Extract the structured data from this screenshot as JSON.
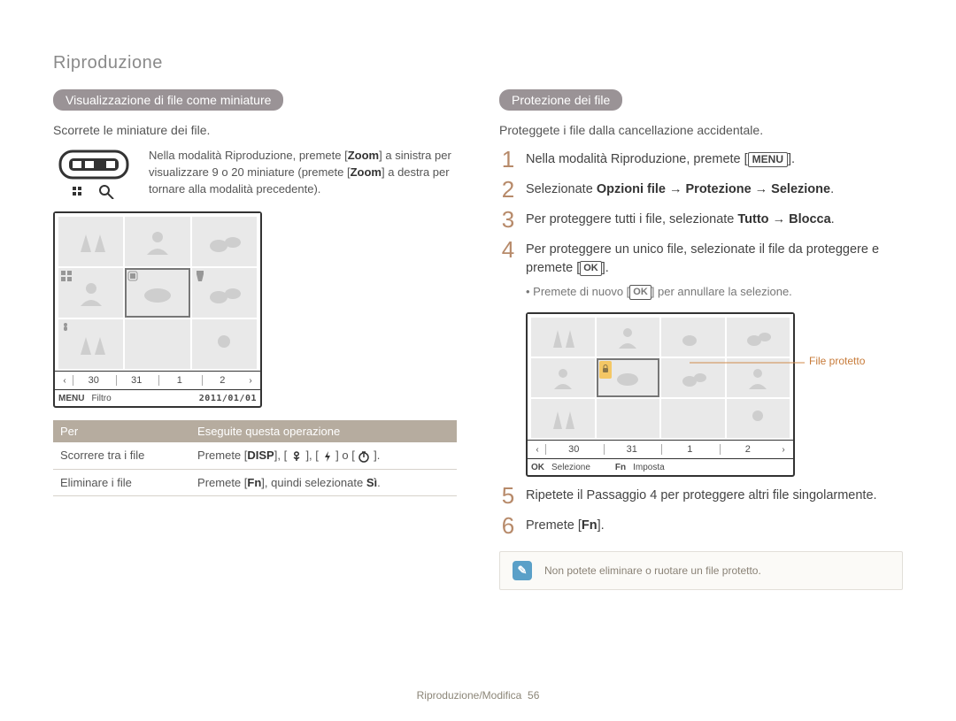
{
  "breadcrumb": "Riproduzione",
  "left": {
    "heading_pill": "Visualizzazione di file come miniature",
    "lead": "Scorrete le miniature dei file.",
    "zoom_hint_a": "Nella modalità Riproduzione, premete [",
    "zoom_label": "Zoom",
    "zoom_hint_b": "] a sinistra per visualizzare 9 o 20 miniature (premete [",
    "zoom_hint_c": "] a destra per tornare alla modalità precedente).",
    "date_strip": {
      "l_arrow": "‹",
      "cells": [
        "30",
        "31",
        "1",
        "2"
      ],
      "r_arrow": "›"
    },
    "filter_strip": {
      "menu_label": "MENU",
      "filter_label": "Filtro",
      "date": "2011/01/01"
    },
    "table": {
      "th1": "Per",
      "th2": "Eseguite questa operazione",
      "r1c1": "Scorrere tra i file",
      "r1c2_a": "Premete [",
      "r1c2_disp": "DISP",
      "r1c2_b": "], [",
      "r1c2_c": "], [",
      "r1c2_d": "] o [",
      "r1c2_e": "].",
      "r2c1": "Eliminare i file",
      "r2c2_a": "Premete [",
      "r2c2_fn": "Fn",
      "r2c2_b": "], quindi selezionate ",
      "r2c2_si": "Sì",
      "r2c2_c": "."
    }
  },
  "right": {
    "heading_pill": "Protezione dei file",
    "lead": "Proteggete i file dalla cancellazione accidentale.",
    "step1_a": "Nella modalità Riproduzione, premete [",
    "step1_menu": "MENU",
    "step1_b": "].",
    "step2_a": "Selezionate ",
    "step2_bold": "Opzioni file → Protezione → Selezione",
    "step2_b": ".",
    "step3_a": "Per proteggere tutti i file, selezionate ",
    "step3_bold": "Tutto → Blocca",
    "step3_b": ".",
    "step4_a": "Per proteggere un unico file, selezionate il file da proteggere e premete [",
    "step4_ok": "OK",
    "step4_b": "].",
    "step4_sub_a": "Premete di nuovo [",
    "step4_sub_ok": "OK",
    "step4_sub_b": "] per annullare la selezione.",
    "callout_label": "File protetto",
    "sel_strip": {
      "ok": "OK",
      "ok_label": "Selezione",
      "fn": "Fn",
      "fn_label": "Imposta"
    },
    "step5": "Ripetete il Passaggio 4 per proteggere altri file singolarmente.",
    "step6_a": "Premete [",
    "step6_fn": "Fn",
    "step6_b": "].",
    "tip": "Non potete eliminare o ruotare un file protetto."
  },
  "footer": {
    "a": "Riproduzione/Modifica",
    "pg": "56"
  }
}
